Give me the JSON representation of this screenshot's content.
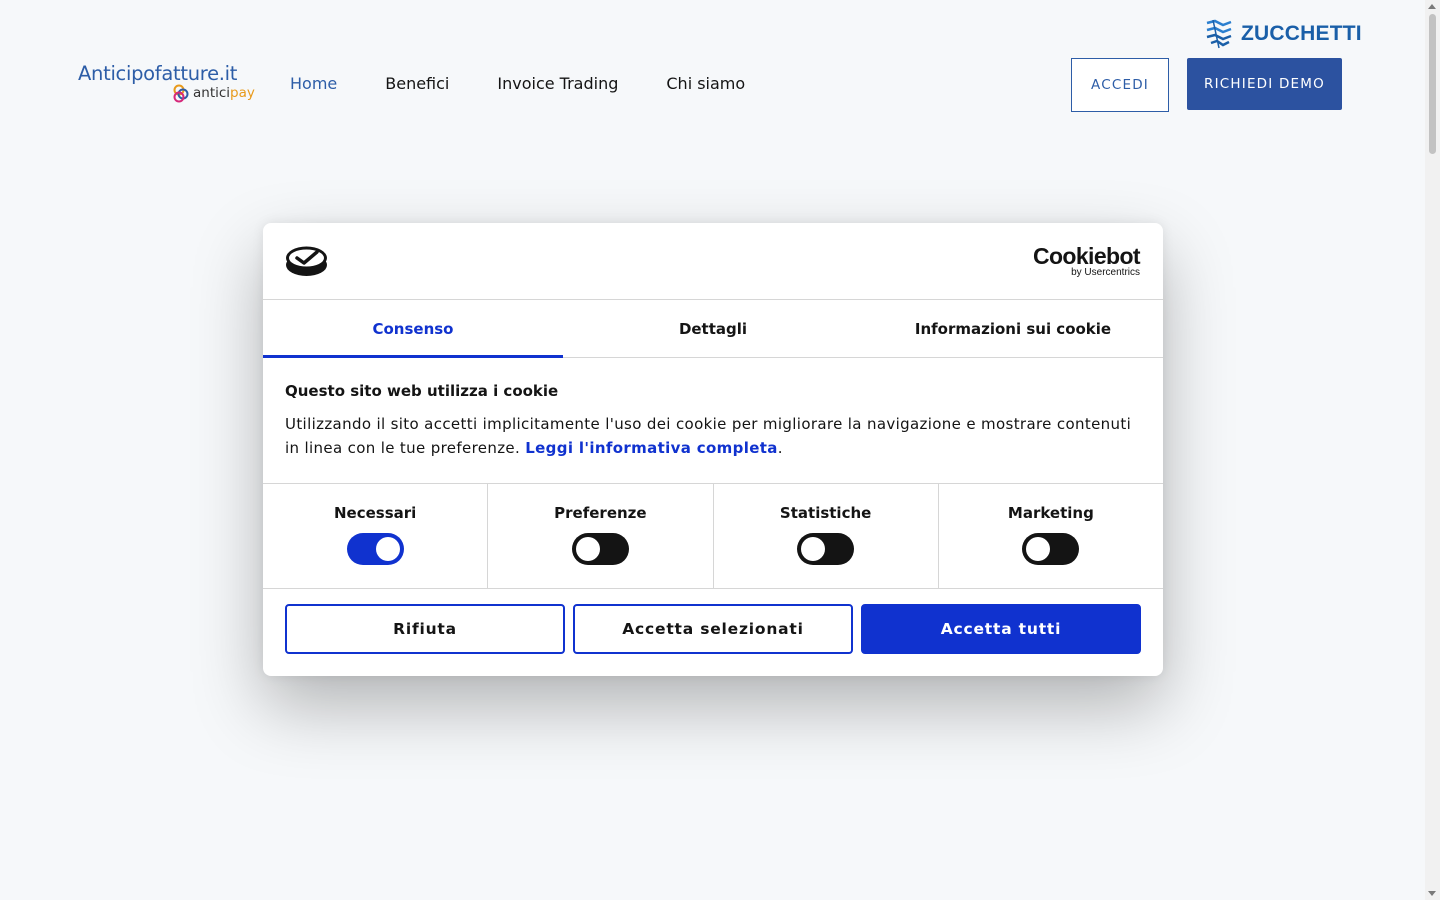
{
  "header": {
    "zucchetti_label": "ZUCCHETTI",
    "logo_main": "Anticipofatture.it",
    "logo_sub_1": "antici",
    "logo_sub_2": "pay",
    "nav": [
      {
        "label": "Home",
        "active": true
      },
      {
        "label": "Benefici"
      },
      {
        "label": "Invoice Trading"
      },
      {
        "label": "Chi siamo"
      }
    ],
    "login_label": "ACCEDI",
    "demo_label": "RICHIEDI DEMO"
  },
  "cookie_dialog": {
    "brand_name": "Cookiebot",
    "brand_sub": "by Usercentrics",
    "tabs": [
      {
        "label": "Consenso",
        "active": true
      },
      {
        "label": "Dettagli"
      },
      {
        "label": "Informazioni sui cookie"
      }
    ],
    "heading": "Questo sito web utilizza i cookie",
    "body_text": "Utilizzando il sito accetti implicitamente l'uso dei cookie per migliorare la navigazione e mostrare contenuti in linea con le tue preferenze. ",
    "policy_link": "Leggi l'informativa completa",
    "body_end": ".",
    "toggles": [
      {
        "label": "Necessari",
        "on": true
      },
      {
        "label": "Preferenze",
        "on": false
      },
      {
        "label": "Statistiche",
        "on": false
      },
      {
        "label": "Marketing",
        "on": false
      }
    ],
    "buttons": {
      "reject": "Rifiuta",
      "accept_selected": "Accetta selezionati",
      "accept_all": "Accetta tutti"
    }
  },
  "colors": {
    "accent": "#1032cf",
    "brand_blue": "#2d5da7",
    "page_bg": "#f6f8fa"
  }
}
